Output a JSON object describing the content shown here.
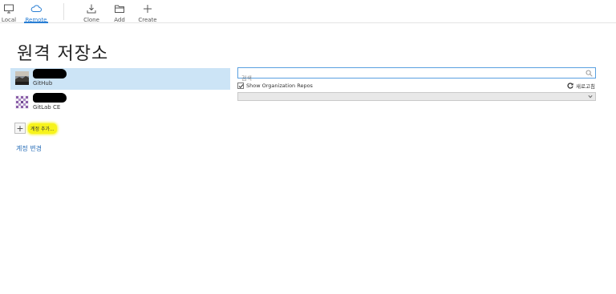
{
  "toolbar": {
    "local_label": "Local",
    "remote_label": "Remote",
    "clone_label": "Clone",
    "add_label": "Add",
    "create_label": "Create",
    "active_tab": "Remote",
    "accent": "#2a7fd4"
  },
  "page": {
    "title": "원격 저장소"
  },
  "accounts": [
    {
      "service": "GitHub",
      "selected": true
    },
    {
      "service": "GitLab CE",
      "selected": false
    }
  ],
  "actions": {
    "add_account_label": "계정 추가...",
    "change_account_label": "계정 변경"
  },
  "repos": {
    "search_placeholder": "검색",
    "show_org_label": "Show Organization Repos",
    "show_org_checked": true,
    "refresh_label": "새로고침",
    "selected_value": ""
  },
  "colors": {
    "selection": "#cce4f6",
    "highlight": "#f7f31b",
    "link": "#2a6fb8"
  }
}
